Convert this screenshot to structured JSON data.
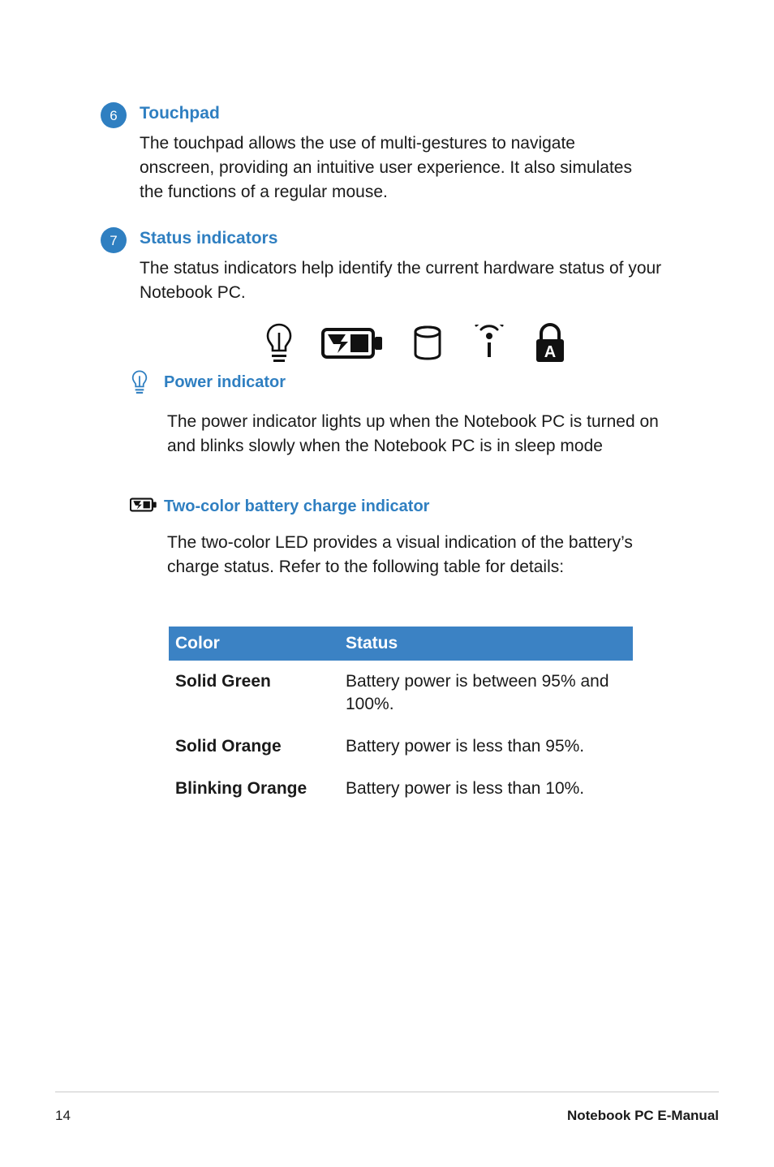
{
  "sections": [
    {
      "number": "6",
      "title": "Touchpad",
      "body": "The touchpad allows the use of multi-gestures to navigate onscreen, providing an intuitive user experience. It also simulates the functions of a regular mouse."
    },
    {
      "number": "7",
      "title": "Status indicators",
      "body": "The status indicators help identify the current hardware status of your Notebook PC."
    }
  ],
  "status_icons": [
    {
      "name": "power-indicator-icon"
    },
    {
      "name": "battery-charge-icon"
    },
    {
      "name": "drive-activity-icon"
    },
    {
      "name": "wireless-bluetooth-icon"
    },
    {
      "name": "capital-lock-icon"
    }
  ],
  "indicators": [
    {
      "icon": "power-indicator-icon",
      "title": "Power indicator",
      "body": "The power indicator lights up when the Notebook PC is turned on and blinks slowly when the Notebook PC is in sleep mode"
    },
    {
      "icon": "battery-charge-icon",
      "title": "Two-color battery charge indicator",
      "body": "The two-color LED provides a visual indication of the battery’s charge status. Refer to the following table for details:"
    }
  ],
  "table": {
    "headers": [
      "Color",
      "Status"
    ],
    "rows": [
      {
        "color": "Solid Green",
        "status": "Battery power is between 95% and 100%."
      },
      {
        "color": "Solid Orange",
        "status": "Battery power is less than 95%."
      },
      {
        "color": "Blinking Orange",
        "status": "Battery power is less than 10%."
      }
    ]
  },
  "footer": {
    "page_number": "14",
    "document_title": "Notebook PC E-Manual"
  },
  "colors": {
    "accent": "#2f7fc1",
    "table_header_bg": "#3b82c4",
    "text": "#1a1a1a"
  }
}
